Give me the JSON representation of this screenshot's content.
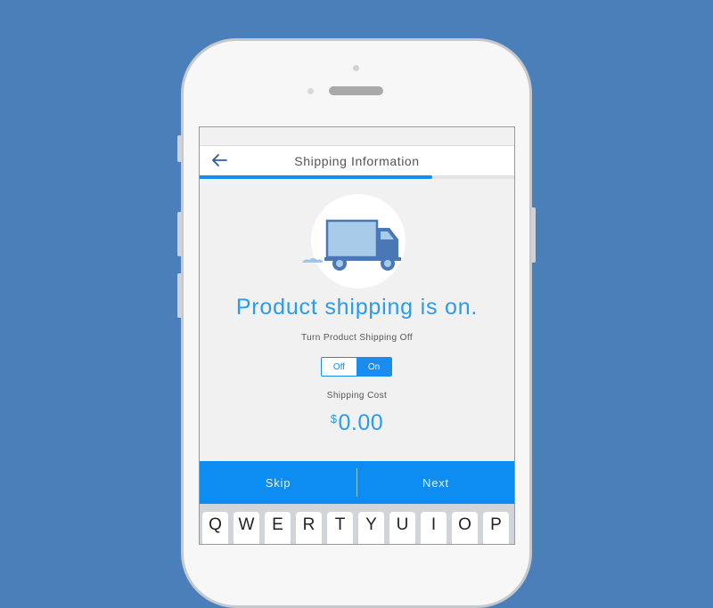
{
  "nav": {
    "back_icon": "arrow-left-icon",
    "title": "Shipping Information",
    "progress_fraction": 0.74
  },
  "hero": {
    "icon": "delivery-truck-icon"
  },
  "main": {
    "headline": "Product shipping is on.",
    "toggle_label": "Turn Product Shipping Off",
    "toggle": {
      "off_label": "Off",
      "on_label": "On",
      "selected": "On"
    },
    "cost_label": "Shipping Cost",
    "cost_currency": "$",
    "cost_value": "0.00"
  },
  "actions": {
    "skip_label": "Skip",
    "next_label": "Next"
  },
  "keyboard": {
    "row1": [
      "Q",
      "W",
      "E",
      "R",
      "T",
      "Y",
      "U",
      "I",
      "O",
      "P"
    ]
  },
  "colors": {
    "background": "#4a7fba",
    "accent": "#1a8cf0",
    "headline": "#2a9bee",
    "action_bar": "#0d8df2"
  }
}
